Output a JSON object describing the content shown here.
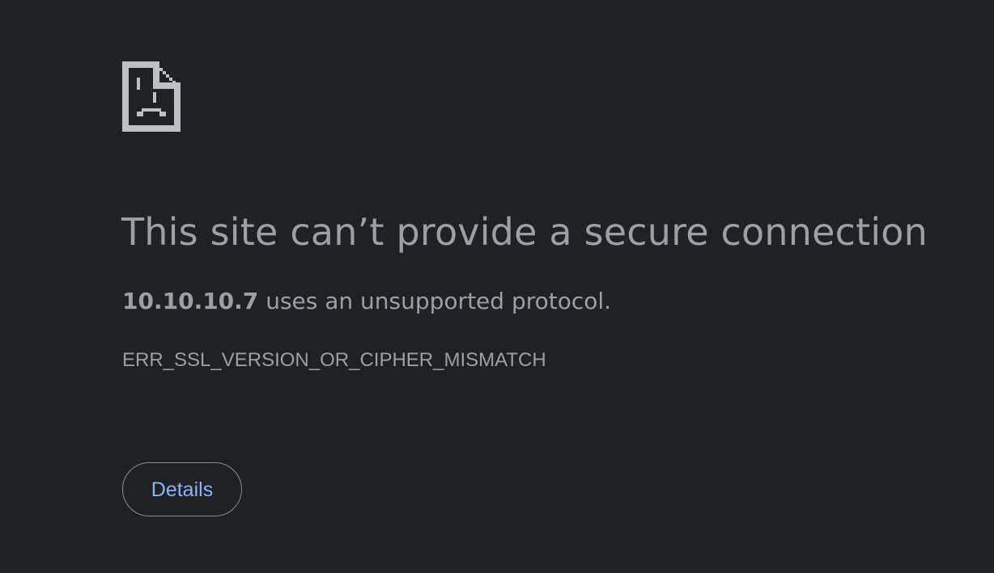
{
  "icon": "sad-page-icon",
  "heading": "This site can’t provide a secure connection",
  "summary": {
    "host": "10.10.10.7",
    "message": " uses an unsupported protocol."
  },
  "error_code": "ERR_SSL_VERSION_OR_CIPHER_MISMATCH",
  "details_button": "Details",
  "colors": {
    "background": "#202124",
    "text": "#9aa0a6",
    "link": "#8ab4f8",
    "icon": "#bdc1c6"
  }
}
